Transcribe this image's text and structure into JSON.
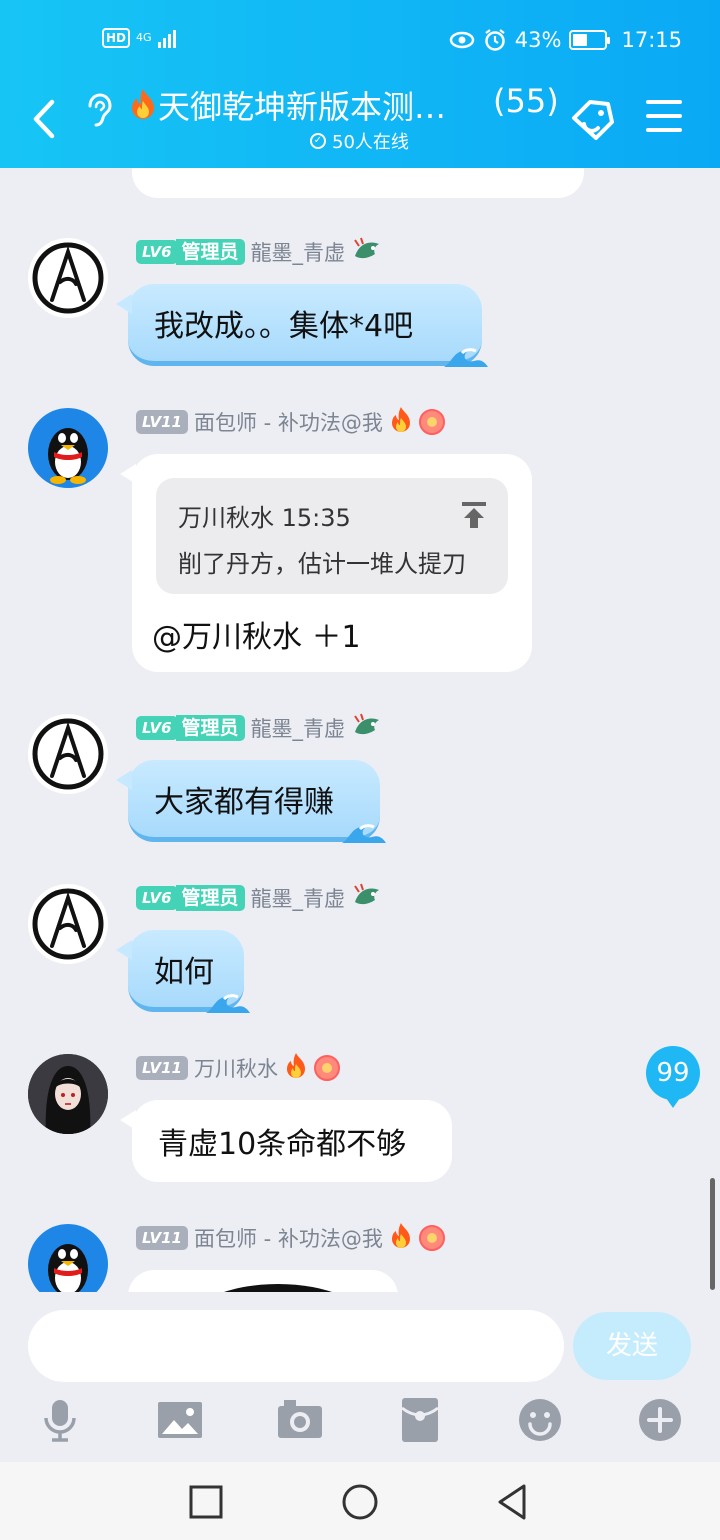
{
  "status_bar": {
    "network": "4G",
    "battery": "43%",
    "time": "17:15"
  },
  "header": {
    "title": "天御乾坤新版本测…",
    "member_count": "(55)",
    "online": "50人在线"
  },
  "messages": [
    {
      "level": "LV6",
      "role": "管理员",
      "name": "龍墨_青虚",
      "text": "我改成。。集体*4吧"
    },
    {
      "level": "LV11",
      "name": "面包师 - 补功法@我",
      "quote_header": "万川秋水 15:35",
      "quote_text": "削了丹方，估计一堆人提刀",
      "text": "@万川秋水 ＋1"
    },
    {
      "level": "LV6",
      "role": "管理员",
      "name": "龍墨_青虚",
      "text": "大家都有得赚"
    },
    {
      "level": "LV6",
      "role": "管理员",
      "name": "龍墨_青虚",
      "text": "如何"
    },
    {
      "level": "LV11",
      "name": "万川秋水",
      "text": "青虚10条命都不够"
    },
    {
      "level": "LV11",
      "name": "面包师 - 补功法@我"
    }
  ],
  "unread_badge": "99",
  "input": {
    "placeholder": "",
    "send_label": "发送"
  },
  "toolbar_icons": [
    "microphone-icon",
    "image-icon",
    "camera-icon",
    "red-packet-icon",
    "emoji-icon",
    "plus-icon"
  ],
  "colors": {
    "header": "#0aa9f5",
    "admin_badge": "#45d3b7",
    "bubble_blue": "#a8dafc",
    "send_button": "#c5ecfc"
  }
}
